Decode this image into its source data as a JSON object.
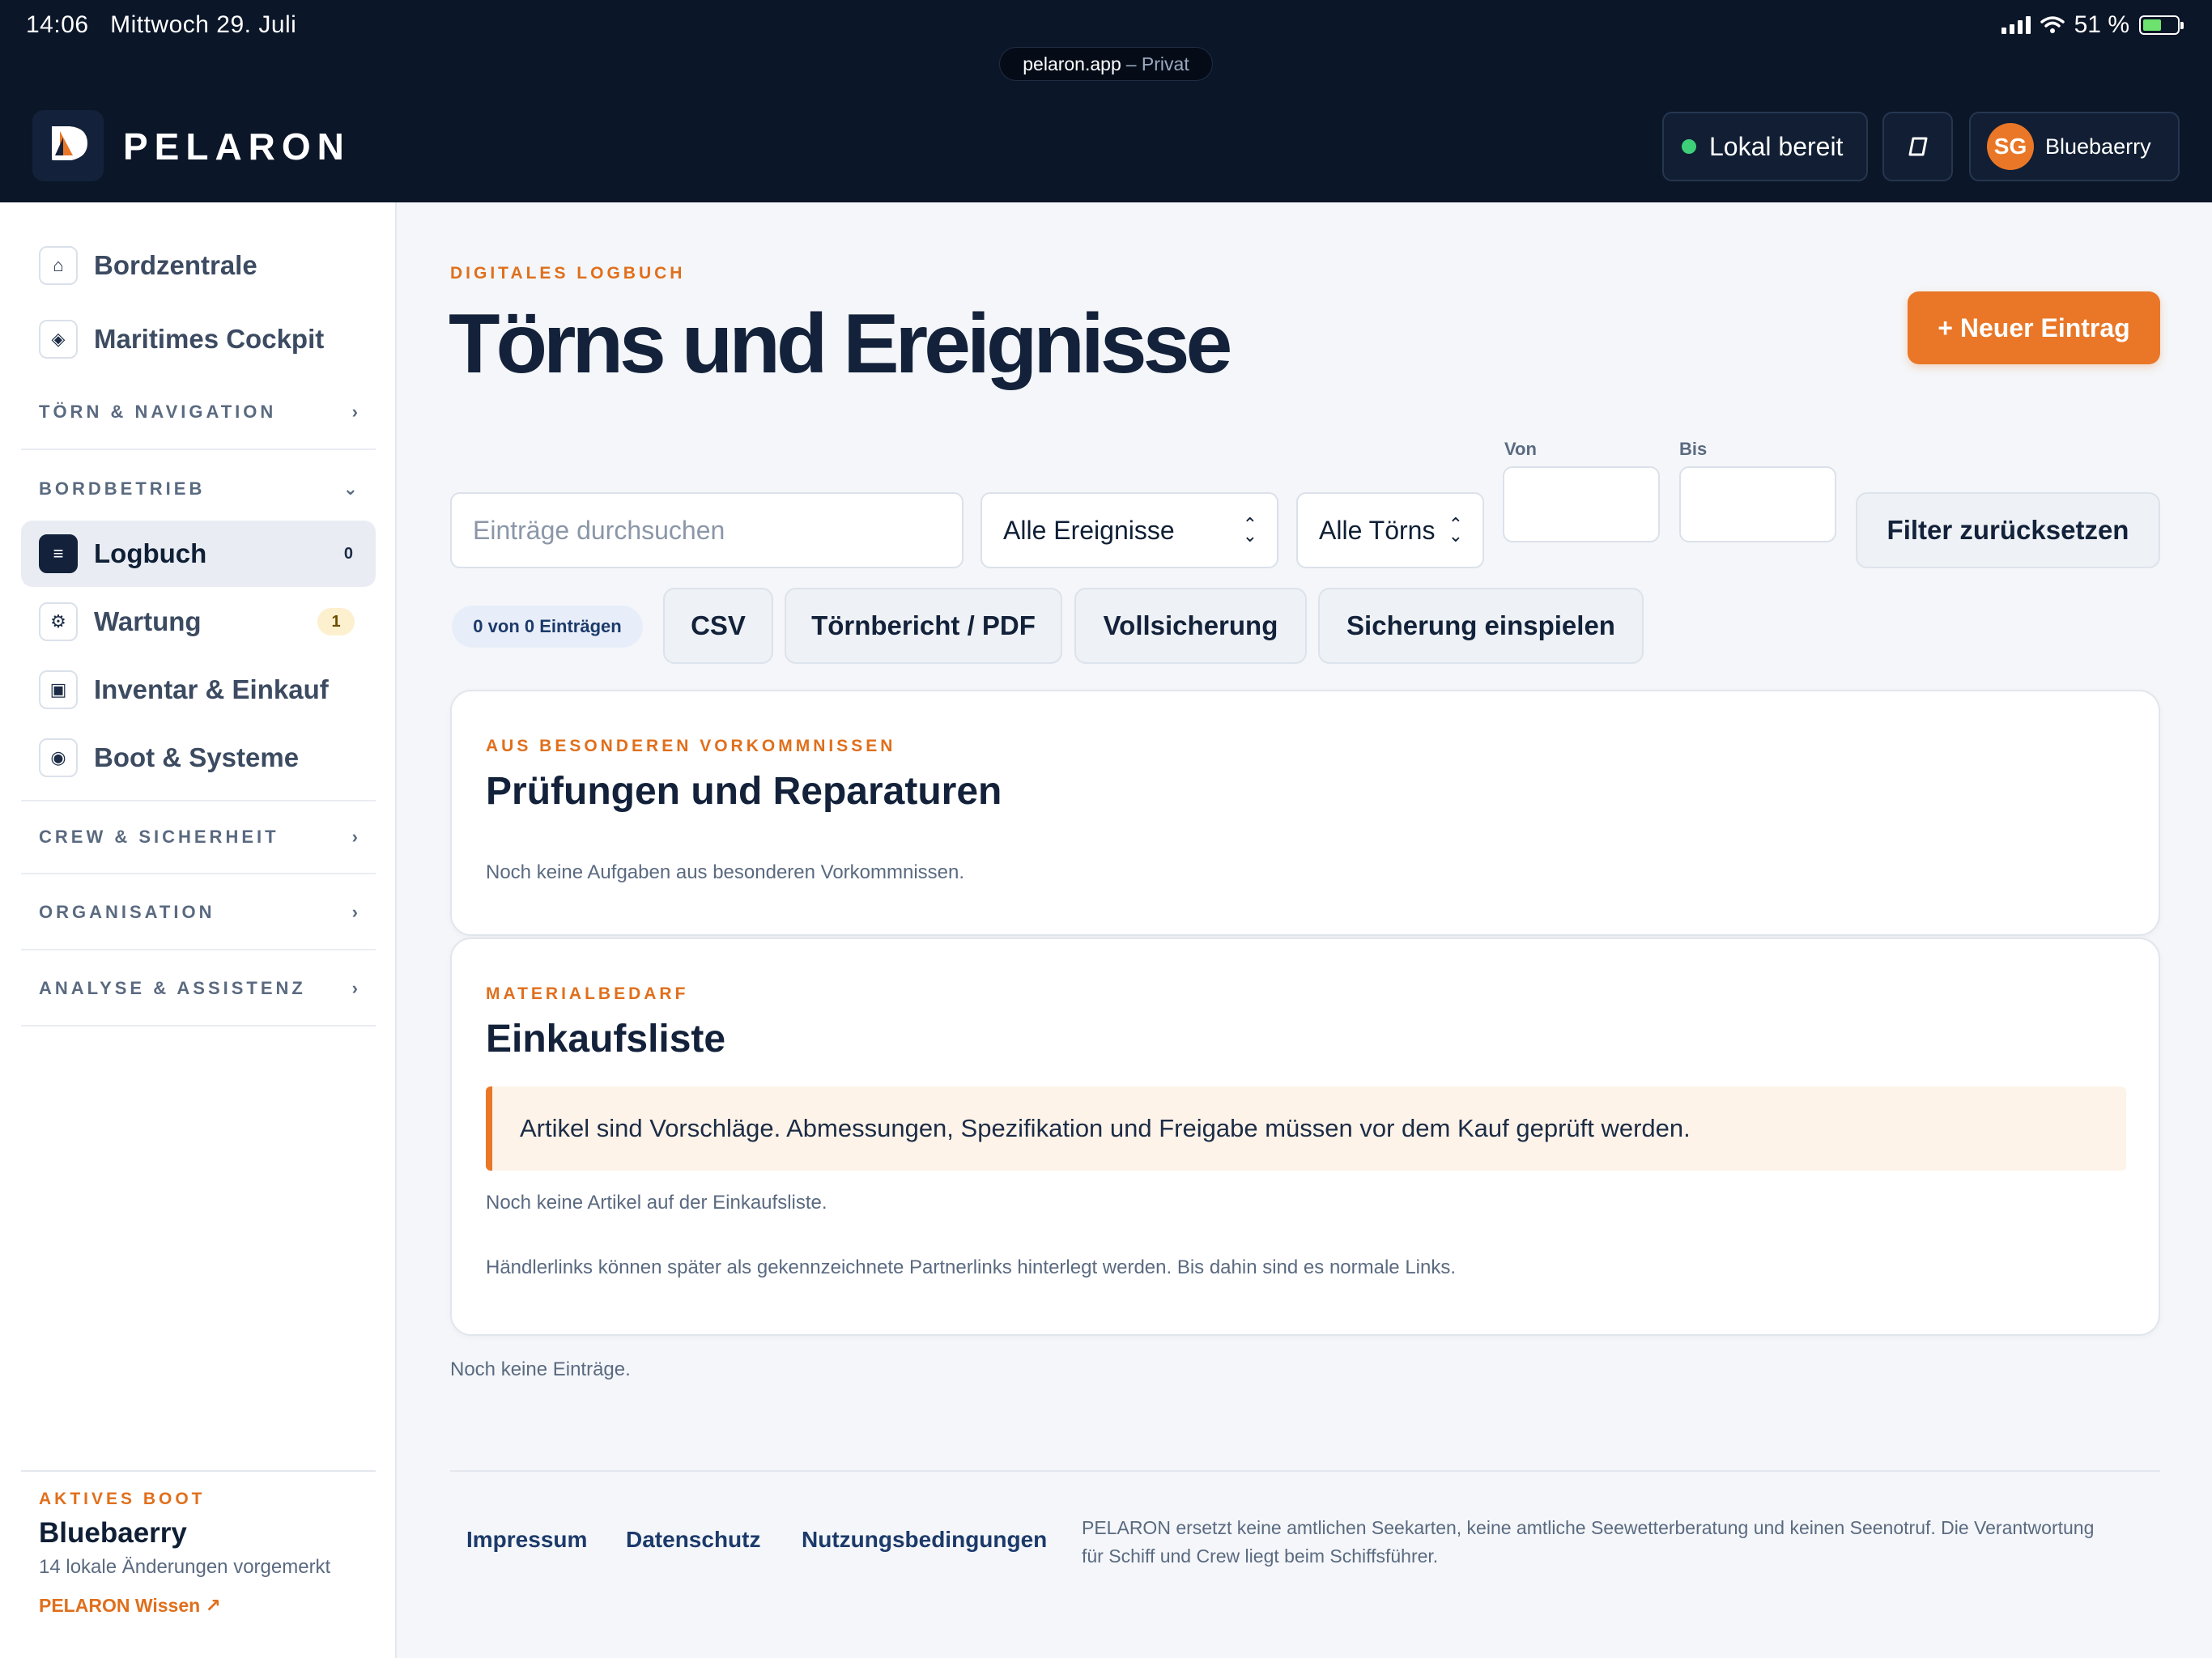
{
  "status": {
    "time": "14:06",
    "date": "Mittwoch 29. Juli",
    "battery": "51 %"
  },
  "browser": {
    "domain": "pelaron.app",
    "mode": "– Privat"
  },
  "header": {
    "brand": "PELARON",
    "local_status": "Lokal bereit",
    "user_initials": "SG",
    "user_name": "Bluebaerry"
  },
  "sidebar": {
    "top_items": [
      {
        "label": "Bordzentrale"
      },
      {
        "label": "Maritimes Cockpit"
      }
    ],
    "sections": {
      "toern": "TÖRN & NAVIGATION",
      "bordbetrieb": "BORDBETRIEB",
      "crew": "CREW & SICHERHEIT",
      "organisation": "ORGANISATION",
      "analyse": "ANALYSE & ASSISTENZ"
    },
    "bordbetrieb_items": [
      {
        "label": "Logbuch",
        "count": "0"
      },
      {
        "label": "Wartung",
        "count": "1"
      },
      {
        "label": "Inventar & Einkauf"
      },
      {
        "label": "Boot & Systeme"
      }
    ],
    "footer": {
      "eyebrow": "AKTIVES BOOT",
      "boat": "Bluebaerry",
      "changes": "14 lokale Änderungen vorgemerkt",
      "link": "PELARON Wissen ↗"
    }
  },
  "main": {
    "eyebrow": "DIGITALES LOGBUCH",
    "title": "Törns und Ereignisse",
    "new_button": "+ Neuer Eintrag",
    "filters": {
      "search_placeholder": "Einträge durchsuchen",
      "event_select": "Alle Ereignisse",
      "toern_select": "Alle Törns",
      "from_label": "Von",
      "to_label": "Bis",
      "reset": "Filter zurücksetzen"
    },
    "actions": {
      "count": "0 von 0 Einträgen",
      "csv": "CSV",
      "pdf": "Törnbericht / PDF",
      "backup": "Vollsicherung",
      "restore": "Sicherung einspielen"
    },
    "card_inspections": {
      "eyebrow": "AUS BESONDEREN VORKOMMNISSEN",
      "title": "Prüfungen und Reparaturen",
      "empty": "Noch keine Aufgaben aus besonderen Vorkommnissen."
    },
    "card_shopping": {
      "eyebrow": "MATERIALBEDARF",
      "title": "Einkaufsliste",
      "notice": "Artikel sind Vorschläge. Abmessungen, Spezifikation und Freigabe müssen vor dem Kauf geprüft werden.",
      "empty": "Noch keine Artikel auf der Einkaufsliste.",
      "partner_note": "Händlerlinks können später als gekennzeichnete Partnerlinks hinterlegt werden. Bis dahin sind es normale Links."
    },
    "empty_entries": "Noch keine Einträge."
  },
  "footer": {
    "impressum": "Impressum",
    "datenschutz": "Datenschutz",
    "terms": "Nutzungsbedingungen",
    "disclaimer": "PELARON ersetzt keine amtlichen Seekarten, keine amtliche Seewetterberatung und keinen Seenotruf. Die Verantwortung für Schiff und Crew liegt beim Schiffsführer."
  },
  "colors": {
    "navy": "#0b1628",
    "accent": "#e97727",
    "ready": "#3ecf79"
  }
}
